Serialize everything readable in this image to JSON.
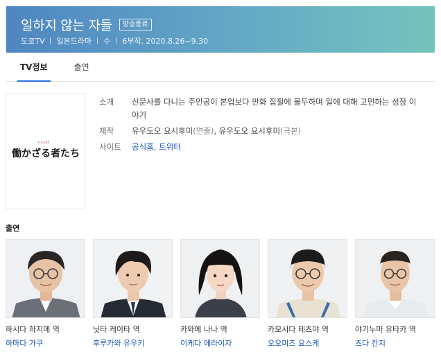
{
  "header": {
    "title": "일하지 않는 자들",
    "badge": "방송종료",
    "meta": [
      "도쿄TV",
      "일본드라마",
      "수",
      "6부작, 2020.8.26~9.30"
    ]
  },
  "tabs": [
    {
      "label": "TV정보",
      "active": true
    },
    {
      "label": "출연",
      "active": false
    }
  ],
  "poster": {
    "logo_text": "働かざる者たち",
    "small_text": "ドラマ25"
  },
  "info": {
    "synopsis_label": "소개",
    "synopsis": "신문사를 다니는 주인공이 본업보다 만화 집필에 몰두하며 일에 대해 고민하는 성장 이야기",
    "production_label": "제작",
    "production_1_name": "유우도오 요시후미",
    "production_1_role": "(연출)",
    "production_sep": ", ",
    "production_2_name": "유우도오 요시후미",
    "production_2_role": "(극본)",
    "site_label": "사이트",
    "site_official": "공식홈",
    "site_sep": ", ",
    "site_twitter": "트위터"
  },
  "cast_section_title": "출연",
  "cast": [
    {
      "role": "하시다 하지메 역",
      "actor": "하마다 가쿠"
    },
    {
      "role": "닛타 케이타 역",
      "actor": "후루카와 유우키"
    },
    {
      "role": "카와에 나나 역",
      "actor": "이케다 에라이자"
    },
    {
      "role": "카모시다 테츠야 역",
      "actor": "오오미즈 요스케"
    },
    {
      "role": "야기누마 유타카 역",
      "actor": "츠다 칸지"
    }
  ]
}
